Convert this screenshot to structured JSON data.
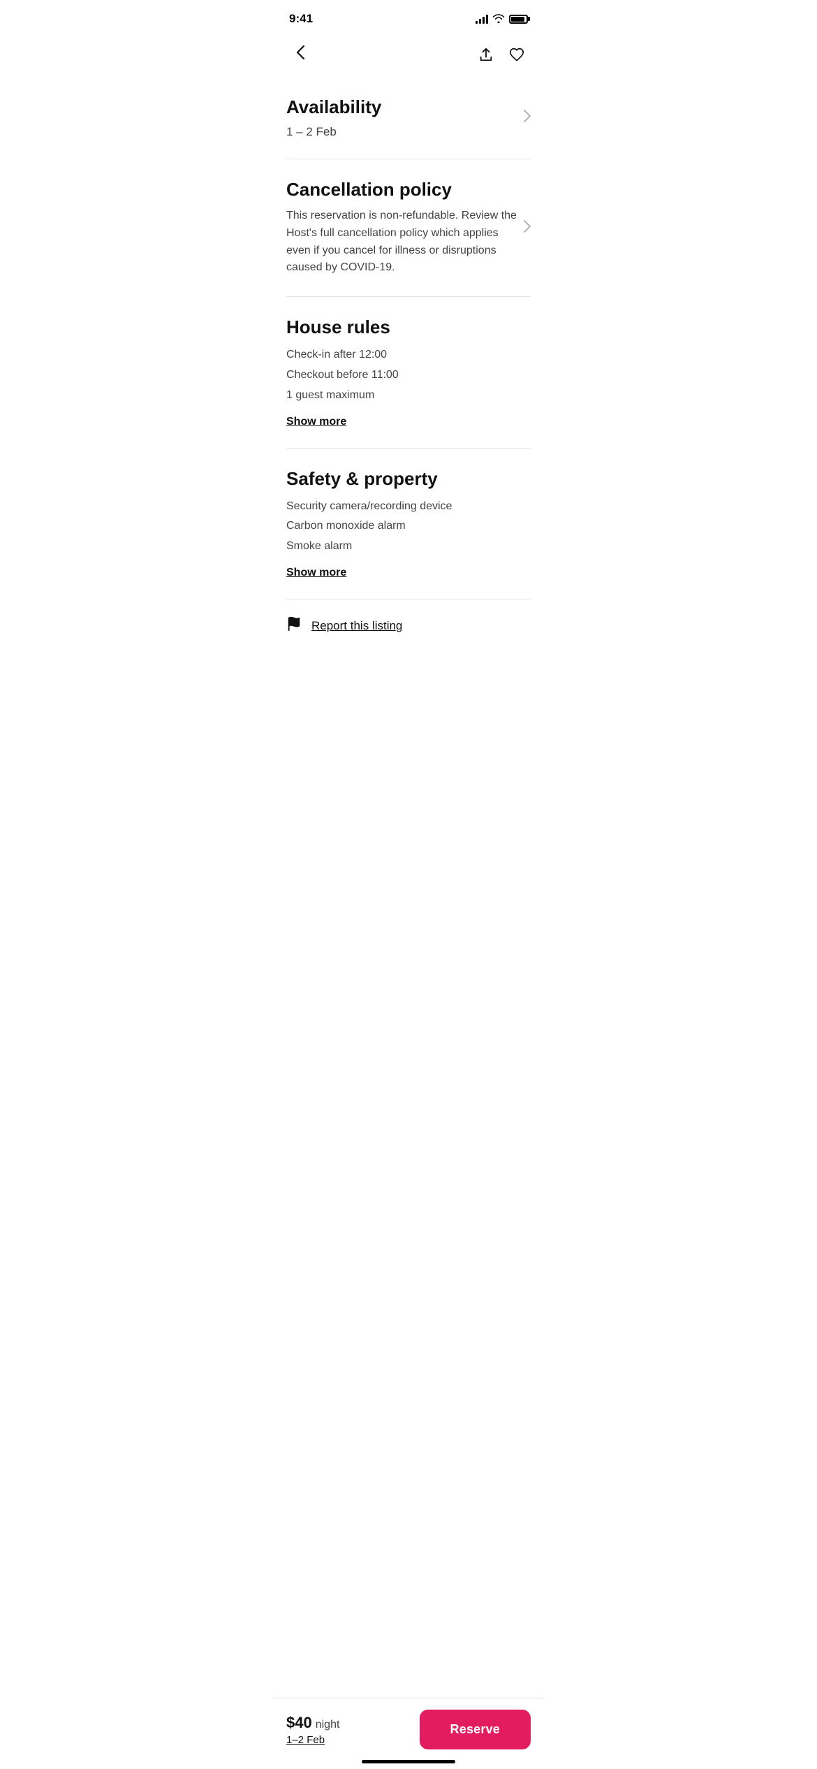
{
  "statusBar": {
    "time": "9:41"
  },
  "nav": {
    "backLabel": "‹",
    "shareLabel": "⬆",
    "heartLabel": "♡"
  },
  "availability": {
    "title": "Availability",
    "dates": "1 – 2 Feb"
  },
  "cancellationPolicy": {
    "title": "Cancellation policy",
    "text": "This reservation is non-refundable. Review the Host's full cancellation policy which applies even if you cancel for illness or disruptions caused by COVID-19."
  },
  "houseRules": {
    "title": "House rules",
    "items": [
      "Check-in after 12:00",
      "Checkout before 11:00",
      "1 guest maximum"
    ],
    "showMore": "Show more"
  },
  "safetyProperty": {
    "title": "Safety & property",
    "items": [
      "Security camera/recording device",
      "Carbon monoxide alarm",
      "Smoke alarm"
    ],
    "showMore": "Show more"
  },
  "report": {
    "text": "Report this listing"
  },
  "bottomBar": {
    "priceAmount": "$40",
    "priceUnit": "night",
    "dates": "1–2 Feb",
    "reserveLabel": "Reserve"
  }
}
